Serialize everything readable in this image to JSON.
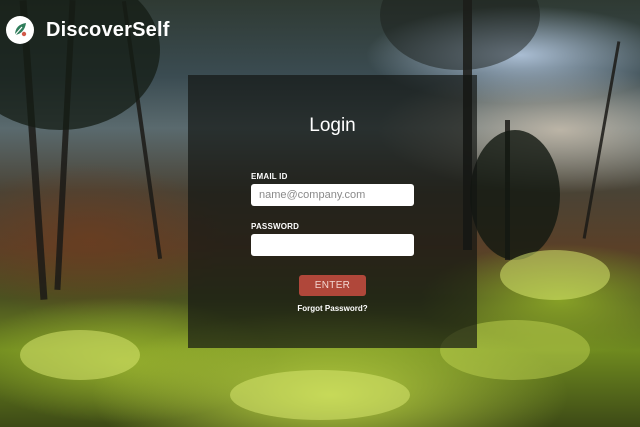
{
  "brand": {
    "name": "DiscoverSelf",
    "logo_icon": "leaf-logo-icon"
  },
  "login": {
    "title": "Login",
    "email_label": "EMAIL ID",
    "email_placeholder": "name@company.com",
    "email_value": "",
    "password_label": "PASSWORD",
    "password_placeholder": "",
    "password_value": "",
    "enter_label": "ENTER",
    "forgot_label": "Forgot Password?"
  },
  "colors": {
    "enter_button": "#b0473a",
    "panel_overlay": "rgba(18,20,18,0.68)",
    "logo_accent": "#2f7d5b"
  }
}
